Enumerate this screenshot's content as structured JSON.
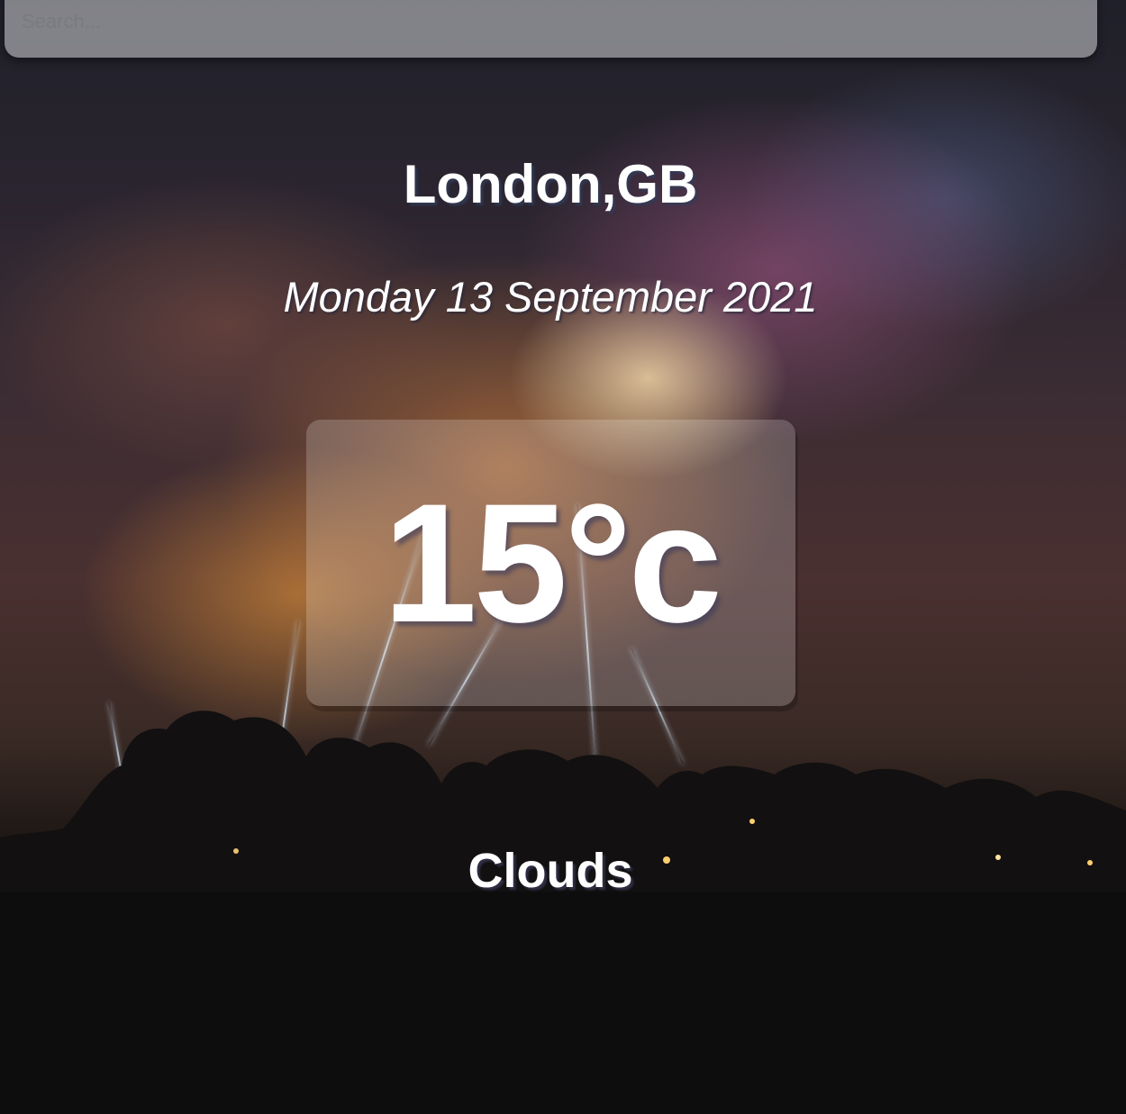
{
  "search": {
    "placeholder": "Search..."
  },
  "location": {
    "city_country": "London,GB"
  },
  "date": {
    "text": "Monday 13 September 2021"
  },
  "weather": {
    "temperature": "15°c",
    "condition": "Clouds"
  },
  "background": {
    "description_icon": "thunderstorm-background"
  }
}
